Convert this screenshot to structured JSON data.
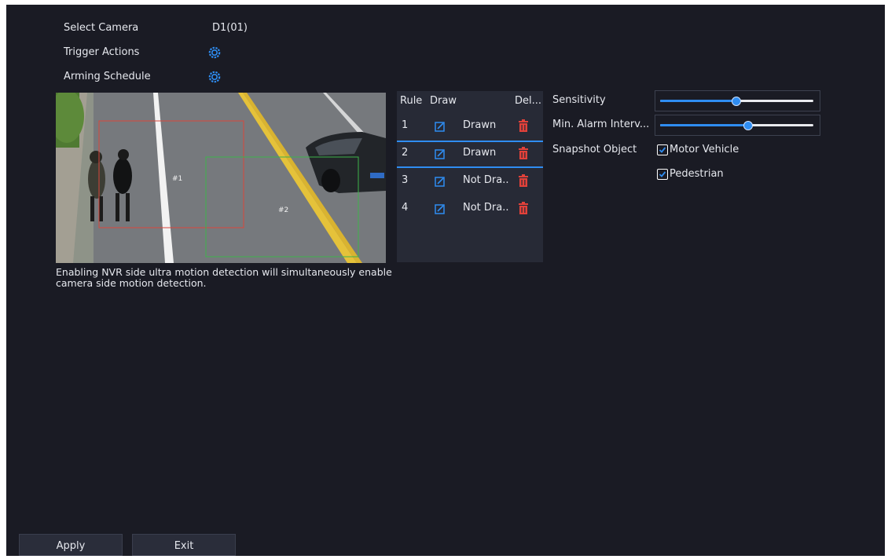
{
  "form": {
    "select_camera_label": "Select Camera",
    "select_camera_value": "D1(01)",
    "trigger_actions_label": "Trigger Actions",
    "arming_schedule_label": "Arming Schedule"
  },
  "preview": {
    "zone1_label": "#1",
    "zone2_label": "#2",
    "note": "Enabling NVR side ultra motion detection will simultaneously enable camera side motion detection."
  },
  "rules_table": {
    "headers": {
      "rule": "Rule",
      "draw": "Draw",
      "delete": "Del..."
    },
    "rows": [
      {
        "rule": "1",
        "status": "Drawn"
      },
      {
        "rule": "2",
        "status": "Drawn"
      },
      {
        "rule": "3",
        "status": "Not Dra.."
      },
      {
        "rule": "4",
        "status": "Not Dra.."
      }
    ]
  },
  "settings": {
    "sensitivity_label": "Sensitivity",
    "sensitivity_level": 0.49,
    "min_alarm_interval_label": "Min. Alarm Interv...",
    "min_alarm_interval_level": 0.57,
    "snapshot_object_label": "Snapshot Object",
    "motor_vehicle_label": "Motor Vehicle",
    "motor_vehicle_checked": true,
    "pedestrian_label": "Pedestrian",
    "pedestrian_checked": true
  },
  "buttons": {
    "apply": "Apply",
    "exit": "Exit"
  },
  "colors": {
    "accent": "#2f8df2",
    "delete": "#e2413a",
    "background": "#1a1b24",
    "zone1": "#d9463c",
    "zone2": "#3db24a"
  },
  "icons": {
    "trigger": "gear-icon",
    "schedule": "gear-icon",
    "draw": "edit-icon",
    "delete": "trash-icon"
  }
}
